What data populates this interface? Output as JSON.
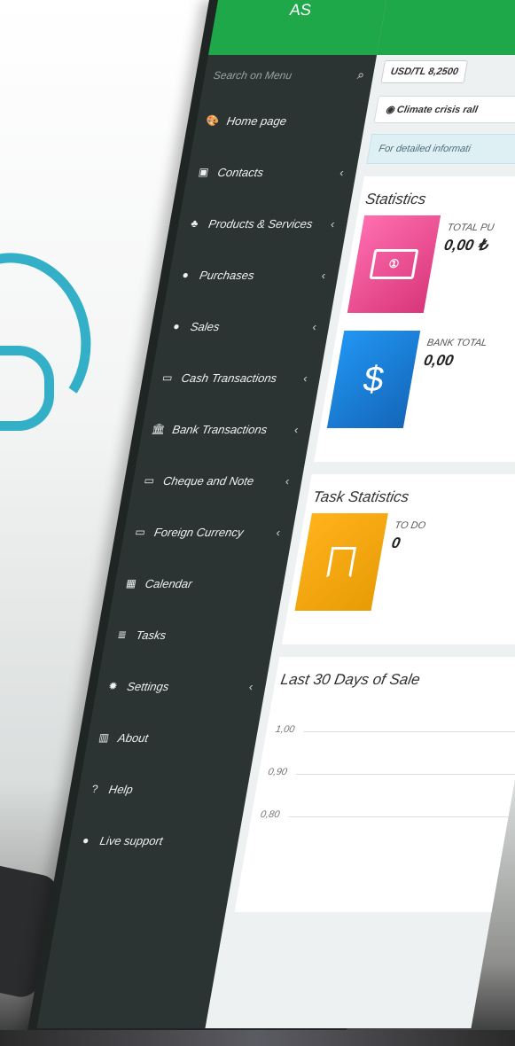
{
  "brand": {
    "text": "AS"
  },
  "search": {
    "placeholder": "Search on Menu"
  },
  "menu": [
    {
      "label": "Home page",
      "icon": "dashboard-icon",
      "glyph": "🎨",
      "chevron": false
    },
    {
      "label": "Contacts",
      "icon": "contacts-icon",
      "glyph": "▣",
      "chevron": true
    },
    {
      "label": "Products & Services",
      "icon": "cubes-icon",
      "glyph": "♣",
      "chevron": true
    },
    {
      "label": "Purchases",
      "icon": "purchase-icon",
      "glyph": "●",
      "chevron": true
    },
    {
      "label": "Sales",
      "icon": "sales-icon",
      "glyph": "●",
      "chevron": true
    },
    {
      "label": "Cash Transactions",
      "icon": "cash-icon",
      "glyph": "▭",
      "chevron": true
    },
    {
      "label": "Bank Transactions",
      "icon": "bank-icon",
      "glyph": "🏛",
      "chevron": true
    },
    {
      "label": "Cheque and Note",
      "icon": "cheque-icon",
      "glyph": "▭",
      "chevron": true
    },
    {
      "label": "Foreign Currency",
      "icon": "currency-icon",
      "glyph": "▭",
      "chevron": true
    },
    {
      "label": "Calendar",
      "icon": "calendar-icon",
      "glyph": "▦",
      "chevron": false
    },
    {
      "label": "Tasks",
      "icon": "tasks-icon",
      "glyph": "≣",
      "chevron": false
    },
    {
      "label": "Settings",
      "icon": "gear-icon",
      "glyph": "✹",
      "chevron": true
    },
    {
      "label": "About",
      "icon": "building-icon",
      "glyph": "▥",
      "chevron": false
    },
    {
      "label": "Help",
      "icon": "help-icon",
      "glyph": "?",
      "chevron": false
    },
    {
      "label": "Live support",
      "icon": "chat-icon",
      "glyph": "●",
      "chevron": false
    }
  ],
  "header": {
    "rate": "USD/TL 8,2500",
    "news": "Climate crisis rall",
    "info": "For detailed informati"
  },
  "statistics": {
    "title": "Statistics",
    "items": [
      {
        "label": "TOTAL PU",
        "value": "0,00 ₺"
      },
      {
        "label": "BANK TOTAL",
        "value": "0,00"
      }
    ]
  },
  "tasks": {
    "title": "Task Statistics",
    "items": [
      {
        "label": "TO DO",
        "value": "0"
      }
    ]
  },
  "sales": {
    "title": "Last 30 Days of Sale",
    "ticks": [
      "1,00",
      "0,90",
      "0,80"
    ]
  },
  "colors": {
    "accent": "#1ea84a",
    "sidebar": "#2b3432",
    "logo": "#33b0c8"
  }
}
